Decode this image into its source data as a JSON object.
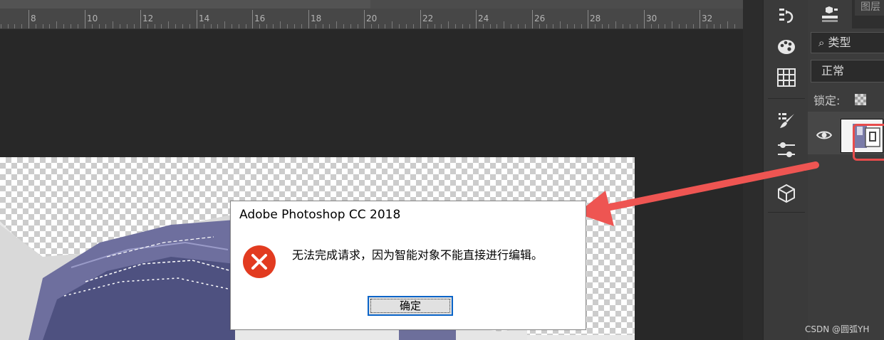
{
  "ruler": {
    "labels": [
      "8",
      "10",
      "12",
      "14",
      "16",
      "18",
      "20",
      "22",
      "24",
      "26",
      "28",
      "30",
      "32"
    ]
  },
  "layers_panel": {
    "tab_label": "图层",
    "filter_label": "类型",
    "blend_mode": "正常",
    "lock_label": "锁定:"
  },
  "tools": {
    "items": [
      "history-icon",
      "palette-icon",
      "grid-icon",
      "brush-preset-icon",
      "adjust-icon",
      "cube-icon"
    ]
  },
  "dialog": {
    "title": "Adobe Photoshop CC 2018",
    "message": "无法完成请求，因为智能对象不能直接进行编辑。",
    "ok_label": "确定"
  },
  "annotation": {
    "arrow_color": "#ee5552",
    "highlight_color": "#e84c4c"
  },
  "watermark": "CSDN @圆弧YH"
}
